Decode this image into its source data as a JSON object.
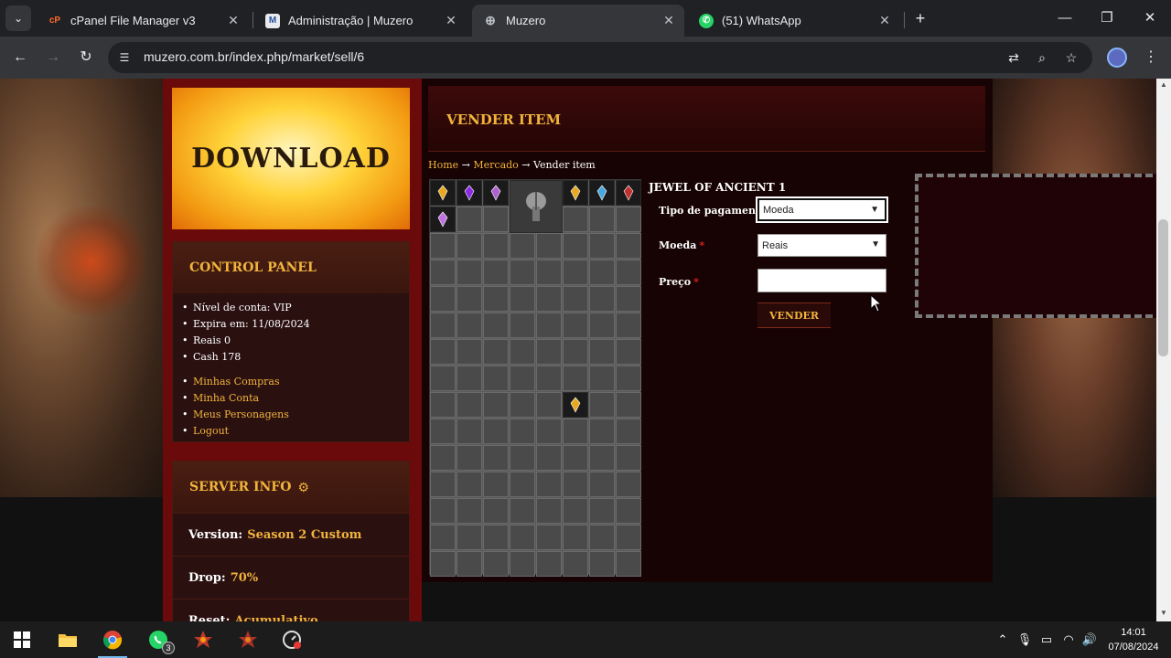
{
  "browser": {
    "tabs": [
      {
        "label": "cPanel File Manager v3",
        "favicon": "cpanel-icon",
        "active": false
      },
      {
        "label": "Administração | Muzero",
        "favicon": "muzero-m-icon",
        "active": false
      },
      {
        "label": "Muzero",
        "favicon": "globe-icon",
        "active": true
      },
      {
        "label": "(51) WhatsApp",
        "favicon": "whatsapp-icon",
        "active": false
      }
    ],
    "url": "muzero.com.br/index.php/market/sell/6"
  },
  "sidebar": {
    "banner_text": "DOWNLOAD",
    "control_panel": {
      "title": "CONTROL PANEL",
      "info": [
        "Nível de conta: VIP",
        "Expira em: 11/08/2024",
        "Reais 0",
        "Cash 178"
      ],
      "links": [
        "Minhas Compras",
        "Minha Conta",
        "Meus Personagens",
        "Logout"
      ]
    },
    "server_info": {
      "title": "SERVER INFO",
      "rows": [
        {
          "label": "Version:",
          "value": "Season 2 Custom"
        },
        {
          "label": "Drop:",
          "value": "70%"
        },
        {
          "label": "Reset:",
          "value": "Acumulativo"
        }
      ]
    }
  },
  "main": {
    "title": "VENDER ITEM",
    "breadcrumb": {
      "home": "Home",
      "arrow": "→",
      "mercado": "Mercado",
      "current": "Vender item"
    },
    "item_name": "JEWEL OF ANCIENT 1",
    "form": {
      "payment_type_label": "Tipo de pagamento",
      "payment_type_value": "Moeda",
      "currency_label": "Moeda",
      "currency_value": "Reais",
      "price_label": "Preço",
      "price_value": "",
      "required_mark": "*",
      "submit_label": "VENDER"
    }
  },
  "taskbar": {
    "time": "14:01",
    "date": "07/08/2024",
    "whatsapp_badge": "3"
  },
  "colors": {
    "accent_gold": "#f0b43c",
    "sidebar_red": "#6b0a0a",
    "chrome_dark": "#202124"
  }
}
